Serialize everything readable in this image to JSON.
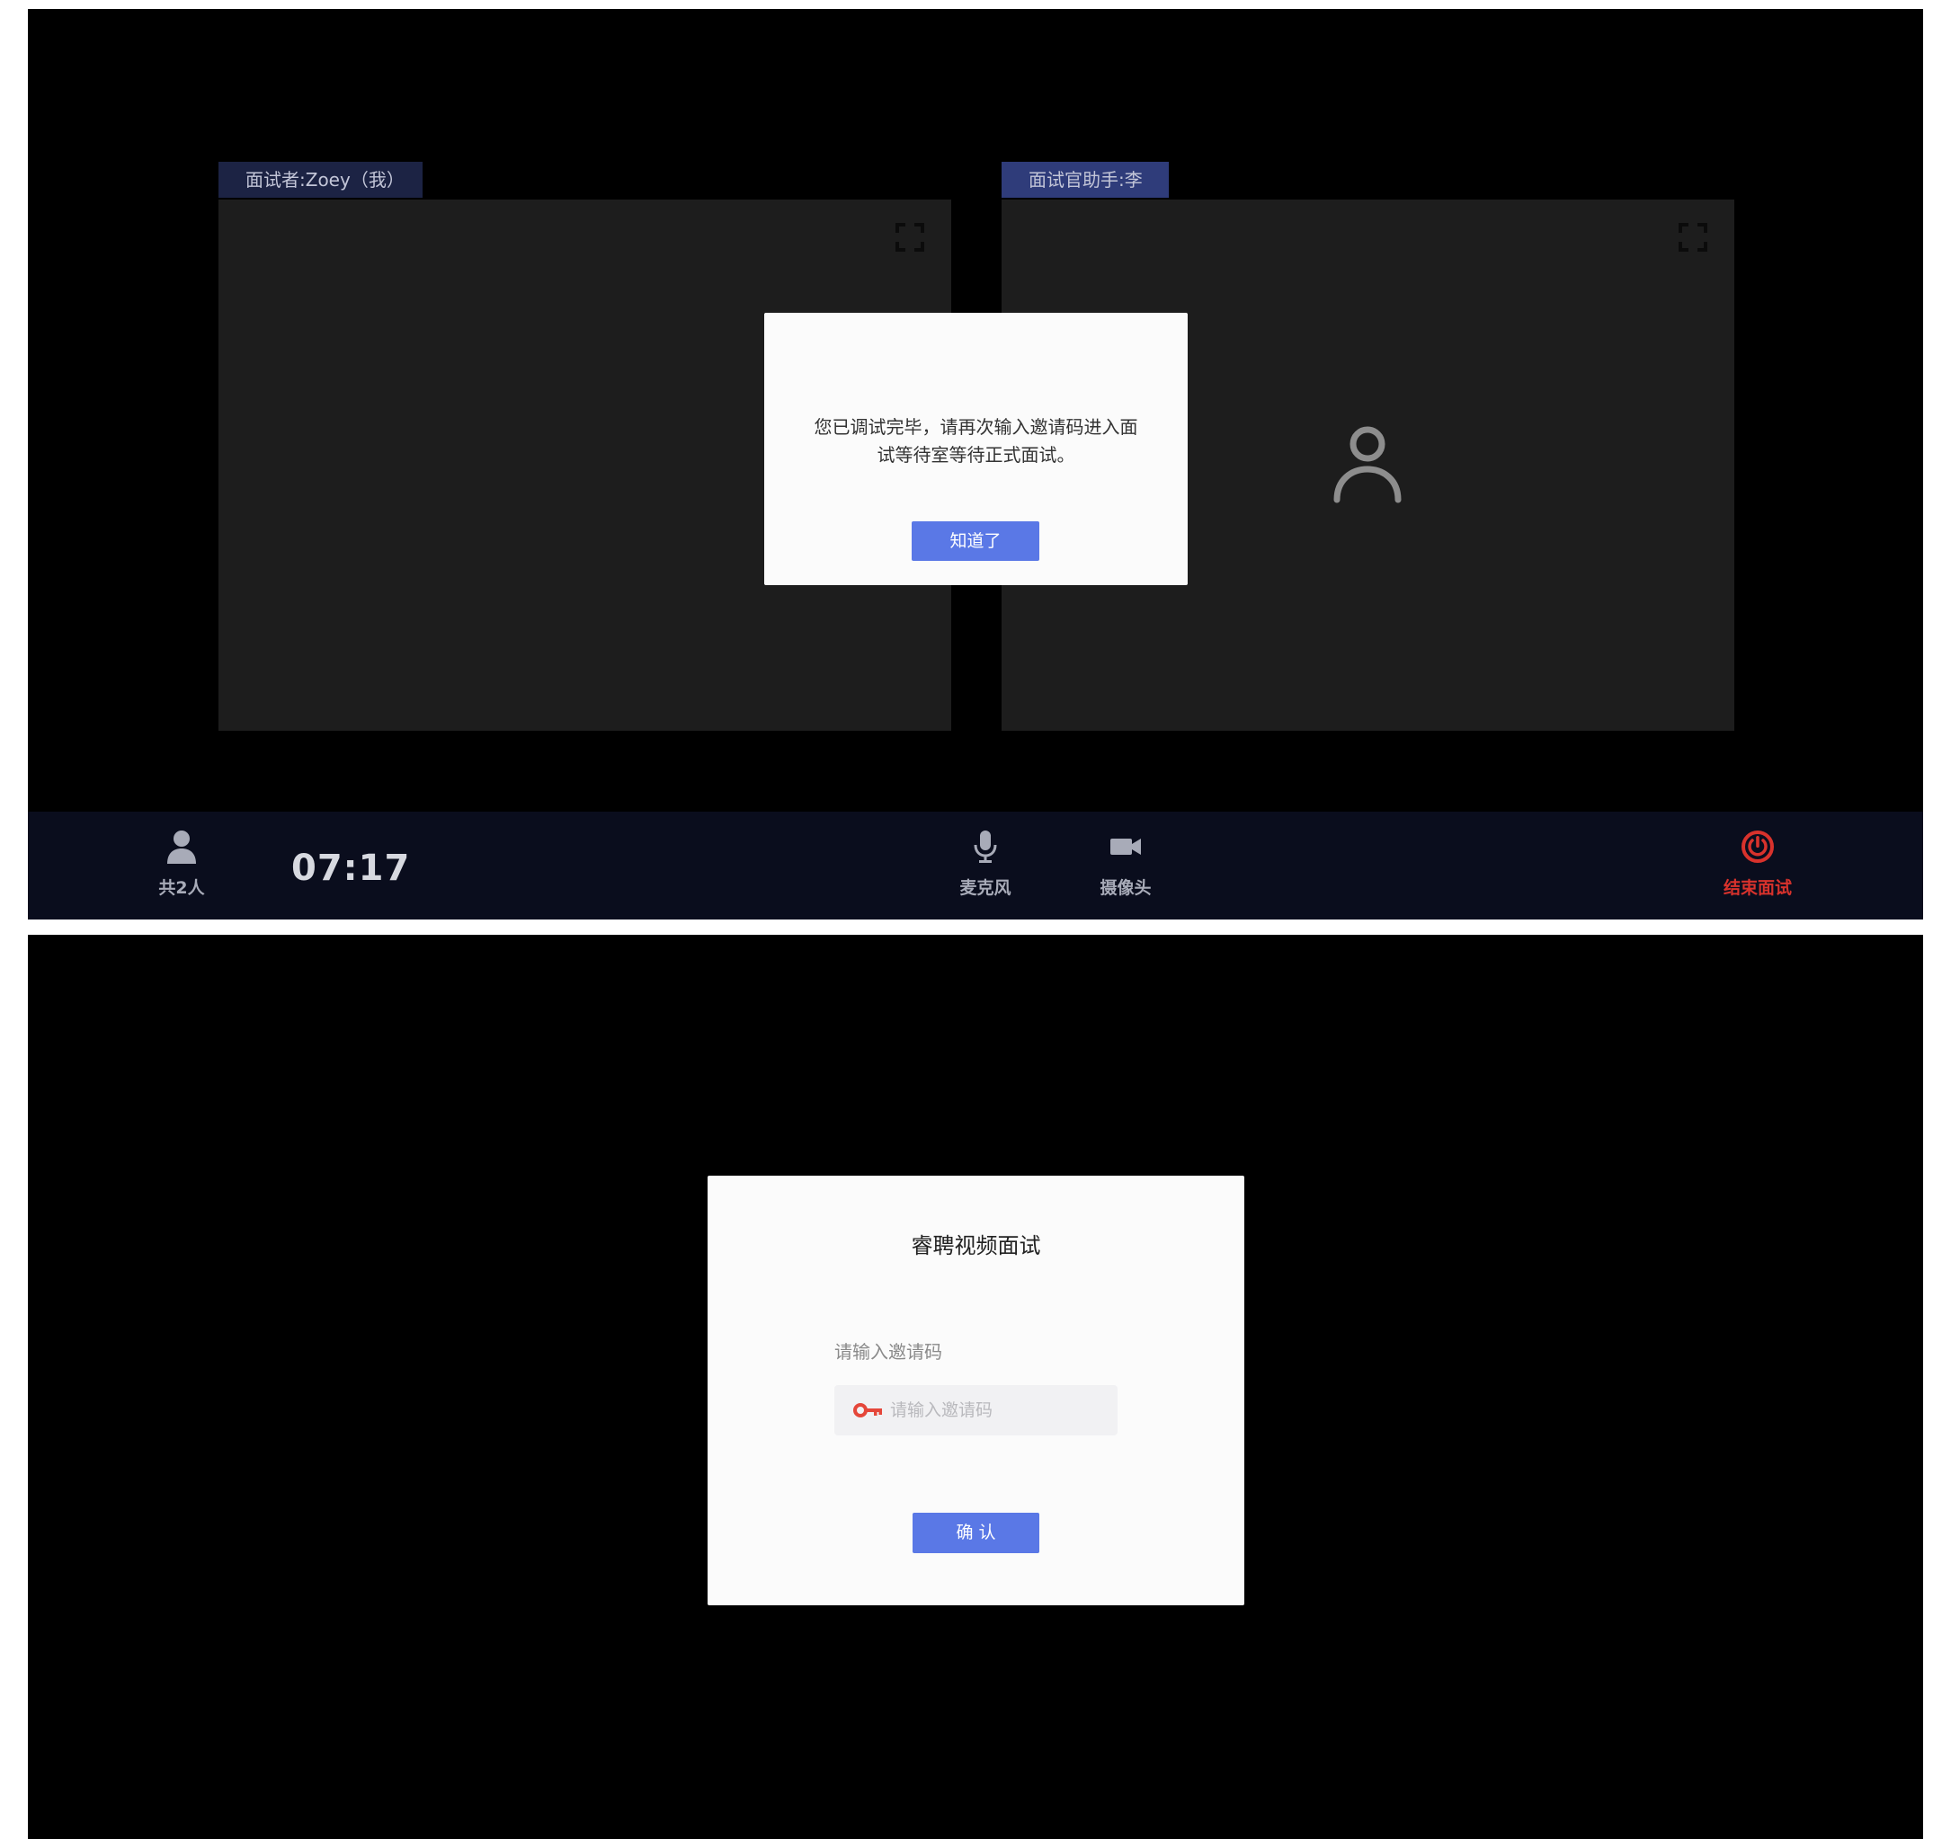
{
  "session": {
    "self_label": "面试者:Zoey（我）",
    "assistant_label": "面试官助手:李"
  },
  "notice_dialog": {
    "message_line1": "您已调试完毕，请再次输入邀请码进入面",
    "message_line2": "试等待室等待正式面试。",
    "ok_label": "知道了"
  },
  "toolbar": {
    "participants_label": "共2人",
    "timer": "07:17",
    "mic_label": "麦克风",
    "camera_label": "摄像头",
    "end_label": "结束面试"
  },
  "invite_dialog": {
    "title": "睿聘视频面试",
    "field_label": "请输入邀请码",
    "placeholder": "请输入邀请码",
    "confirm_label": "确 认"
  },
  "colors": {
    "label_bg_self": "#1c2344",
    "label_bg_assistant": "#2f3c7a",
    "primary": "#5a78e6",
    "danger": "#d8322c",
    "key_icon": "#e5473a"
  }
}
